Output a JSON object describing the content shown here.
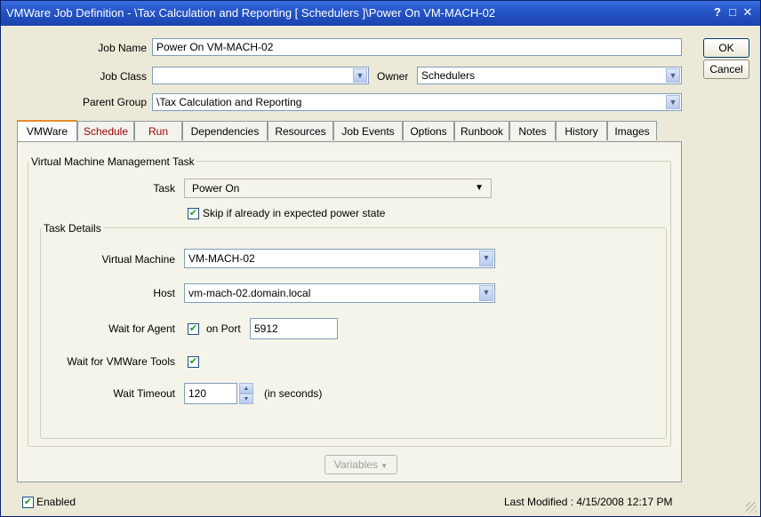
{
  "window": {
    "title": "VMWare Job Definition - \\Tax Calculation and Reporting [ Schedulers ]\\Power On VM-MACH-02",
    "help_icon": "?",
    "maximize_icon": "□",
    "close_icon": "✕"
  },
  "header": {
    "job_name_label": "Job Name",
    "job_name_value": "Power On VM-MACH-02",
    "job_class_label": "Job Class",
    "job_class_value": "",
    "owner_label": "Owner",
    "owner_value": "Schedulers",
    "parent_group_label": "Parent Group",
    "parent_group_value": "\\Tax Calculation and Reporting"
  },
  "buttons": {
    "ok": "OK",
    "cancel": "Cancel",
    "variables": "Variables"
  },
  "tabs": [
    {
      "label": "VMWare"
    },
    {
      "label": "Schedule"
    },
    {
      "label": "Run"
    },
    {
      "label": "Dependencies"
    },
    {
      "label": "Resources"
    },
    {
      "label": "Job Events"
    },
    {
      "label": "Options"
    },
    {
      "label": "Runbook"
    },
    {
      "label": "Notes"
    },
    {
      "label": "History"
    },
    {
      "label": "Images"
    }
  ],
  "task_group": {
    "caption": "Virtual Machine Management Task",
    "task_label": "Task",
    "task_value": "Power On",
    "skip_label": "Skip if already in expected power state",
    "skip_checked": true
  },
  "details": {
    "caption": "Task Details",
    "vm_label": "Virtual Machine",
    "vm_value": "VM-MACH-02",
    "host_label": "Host",
    "host_value": "vm-mach-02.domain.local",
    "wait_agent_label": "Wait for Agent",
    "wait_agent_checked": true,
    "on_port_label": "on Port",
    "port_value": "5912",
    "wait_tools_label": "Wait for VMWare Tools",
    "wait_tools_checked": true,
    "timeout_label": "Wait Timeout",
    "timeout_value": "120",
    "timeout_unit": "(in seconds)"
  },
  "footer": {
    "enabled_label": "Enabled",
    "enabled_checked": true,
    "last_modified": "Last Modified : 4/15/2008 12:17 PM"
  },
  "icons": {
    "check": "✔",
    "dropdown": "▼",
    "spin_up": "▲",
    "spin_down": "▼"
  }
}
